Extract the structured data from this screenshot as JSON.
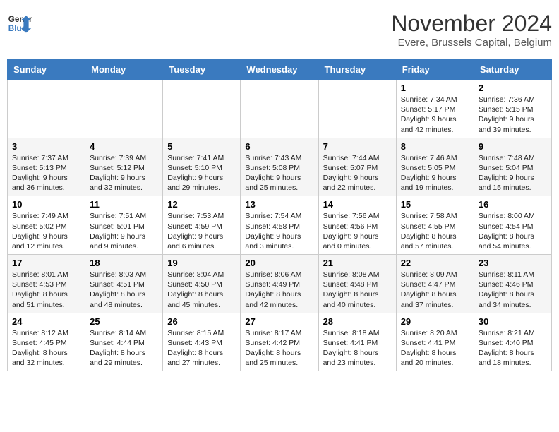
{
  "header": {
    "logo_line1": "General",
    "logo_line2": "Blue",
    "month": "November 2024",
    "location": "Evere, Brussels Capital, Belgium"
  },
  "days_of_week": [
    "Sunday",
    "Monday",
    "Tuesday",
    "Wednesday",
    "Thursday",
    "Friday",
    "Saturday"
  ],
  "weeks": [
    [
      {
        "day": "",
        "info": ""
      },
      {
        "day": "",
        "info": ""
      },
      {
        "day": "",
        "info": ""
      },
      {
        "day": "",
        "info": ""
      },
      {
        "day": "",
        "info": ""
      },
      {
        "day": "1",
        "info": "Sunrise: 7:34 AM\nSunset: 5:17 PM\nDaylight: 9 hours and 42 minutes."
      },
      {
        "day": "2",
        "info": "Sunrise: 7:36 AM\nSunset: 5:15 PM\nDaylight: 9 hours and 39 minutes."
      }
    ],
    [
      {
        "day": "3",
        "info": "Sunrise: 7:37 AM\nSunset: 5:13 PM\nDaylight: 9 hours and 36 minutes."
      },
      {
        "day": "4",
        "info": "Sunrise: 7:39 AM\nSunset: 5:12 PM\nDaylight: 9 hours and 32 minutes."
      },
      {
        "day": "5",
        "info": "Sunrise: 7:41 AM\nSunset: 5:10 PM\nDaylight: 9 hours and 29 minutes."
      },
      {
        "day": "6",
        "info": "Sunrise: 7:43 AM\nSunset: 5:08 PM\nDaylight: 9 hours and 25 minutes."
      },
      {
        "day": "7",
        "info": "Sunrise: 7:44 AM\nSunset: 5:07 PM\nDaylight: 9 hours and 22 minutes."
      },
      {
        "day": "8",
        "info": "Sunrise: 7:46 AM\nSunset: 5:05 PM\nDaylight: 9 hours and 19 minutes."
      },
      {
        "day": "9",
        "info": "Sunrise: 7:48 AM\nSunset: 5:04 PM\nDaylight: 9 hours and 15 minutes."
      }
    ],
    [
      {
        "day": "10",
        "info": "Sunrise: 7:49 AM\nSunset: 5:02 PM\nDaylight: 9 hours and 12 minutes."
      },
      {
        "day": "11",
        "info": "Sunrise: 7:51 AM\nSunset: 5:01 PM\nDaylight: 9 hours and 9 minutes."
      },
      {
        "day": "12",
        "info": "Sunrise: 7:53 AM\nSunset: 4:59 PM\nDaylight: 9 hours and 6 minutes."
      },
      {
        "day": "13",
        "info": "Sunrise: 7:54 AM\nSunset: 4:58 PM\nDaylight: 9 hours and 3 minutes."
      },
      {
        "day": "14",
        "info": "Sunrise: 7:56 AM\nSunset: 4:56 PM\nDaylight: 9 hours and 0 minutes."
      },
      {
        "day": "15",
        "info": "Sunrise: 7:58 AM\nSunset: 4:55 PM\nDaylight: 8 hours and 57 minutes."
      },
      {
        "day": "16",
        "info": "Sunrise: 8:00 AM\nSunset: 4:54 PM\nDaylight: 8 hours and 54 minutes."
      }
    ],
    [
      {
        "day": "17",
        "info": "Sunrise: 8:01 AM\nSunset: 4:53 PM\nDaylight: 8 hours and 51 minutes."
      },
      {
        "day": "18",
        "info": "Sunrise: 8:03 AM\nSunset: 4:51 PM\nDaylight: 8 hours and 48 minutes."
      },
      {
        "day": "19",
        "info": "Sunrise: 8:04 AM\nSunset: 4:50 PM\nDaylight: 8 hours and 45 minutes."
      },
      {
        "day": "20",
        "info": "Sunrise: 8:06 AM\nSunset: 4:49 PM\nDaylight: 8 hours and 42 minutes."
      },
      {
        "day": "21",
        "info": "Sunrise: 8:08 AM\nSunset: 4:48 PM\nDaylight: 8 hours and 40 minutes."
      },
      {
        "day": "22",
        "info": "Sunrise: 8:09 AM\nSunset: 4:47 PM\nDaylight: 8 hours and 37 minutes."
      },
      {
        "day": "23",
        "info": "Sunrise: 8:11 AM\nSunset: 4:46 PM\nDaylight: 8 hours and 34 minutes."
      }
    ],
    [
      {
        "day": "24",
        "info": "Sunrise: 8:12 AM\nSunset: 4:45 PM\nDaylight: 8 hours and 32 minutes."
      },
      {
        "day": "25",
        "info": "Sunrise: 8:14 AM\nSunset: 4:44 PM\nDaylight: 8 hours and 29 minutes."
      },
      {
        "day": "26",
        "info": "Sunrise: 8:15 AM\nSunset: 4:43 PM\nDaylight: 8 hours and 27 minutes."
      },
      {
        "day": "27",
        "info": "Sunrise: 8:17 AM\nSunset: 4:42 PM\nDaylight: 8 hours and 25 minutes."
      },
      {
        "day": "28",
        "info": "Sunrise: 8:18 AM\nSunset: 4:41 PM\nDaylight: 8 hours and 23 minutes."
      },
      {
        "day": "29",
        "info": "Sunrise: 8:20 AM\nSunset: 4:41 PM\nDaylight: 8 hours and 20 minutes."
      },
      {
        "day": "30",
        "info": "Sunrise: 8:21 AM\nSunset: 4:40 PM\nDaylight: 8 hours and 18 minutes."
      }
    ]
  ]
}
